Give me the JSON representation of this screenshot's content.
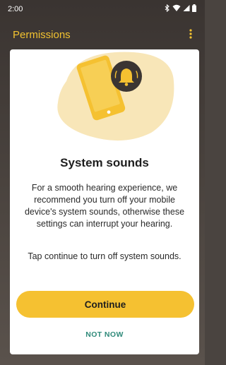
{
  "status_bar": {
    "time": "2:00",
    "icons": [
      "bluetooth-icon",
      "wifi-icon",
      "signal-icon",
      "battery-icon"
    ]
  },
  "app_bar": {
    "title": "Permissions",
    "menu_icon": "overflow-menu-icon"
  },
  "dialog": {
    "illustration_icons": [
      "phone-icon",
      "bell-icon"
    ],
    "title": "System sounds",
    "body": "For a smooth hearing experience, we recommend you turn off your mobile device's system sounds, otherwise these settings can interrupt your hearing.",
    "instruction": "Tap continue to turn off system sounds.",
    "continue_label": "Continue",
    "not_now_label": "NOT NOW"
  },
  "colors": {
    "accent": "#f5c131",
    "title_accent": "#f2c230",
    "link": "#2f8a7a",
    "background": "#4a4440"
  }
}
